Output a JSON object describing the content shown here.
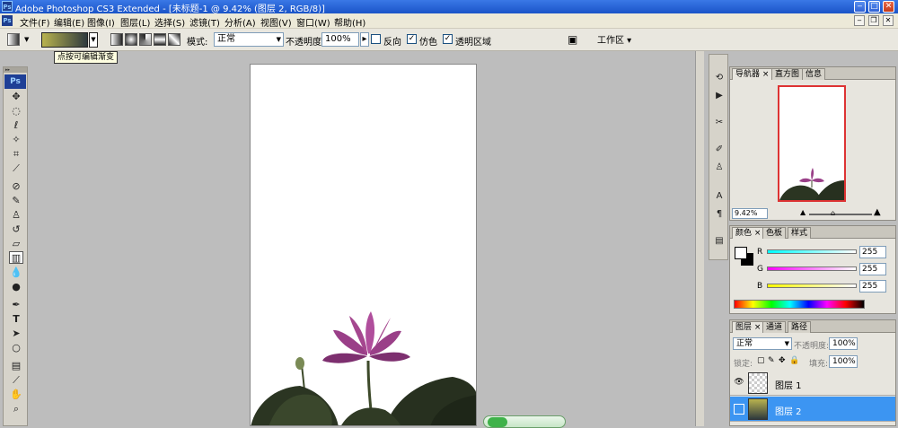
{
  "window": {
    "title": "Adobe Photoshop CS3 Extended - [未标题-1 @ 9.42% (图层 2, RGB/8)]",
    "app_icon": "Ps",
    "controls": [
      "minimize-icon",
      "maximize-icon",
      "close-icon"
    ]
  },
  "menubar": {
    "items": [
      "文件(F)",
      "编辑(E)",
      "图像(I)",
      "图层(L)",
      "选择(S)",
      "滤镜(T)",
      "分析(A)",
      "视图(V)",
      "窗口(W)",
      "帮助(H)"
    ]
  },
  "options": {
    "mode_label": "模式:",
    "mode_value": "正常",
    "opacity_label": "不透明度:",
    "opacity_value": "100%",
    "reverse_label": "反向",
    "reverse_checked": false,
    "dither_label": "仿色",
    "dither_checked": true,
    "transparency_label": "透明区域",
    "transparency_checked": true,
    "workspace_label": "工作区 ▾",
    "gradient_colors": [
      "#b9b34f",
      "#2f3a3e"
    ]
  },
  "tooltip": "点按可编辑渐变",
  "toolbox": {
    "logo": "Ps",
    "tools": [
      "move-tool-icon",
      "marquee-tool-icon",
      "lasso-tool-icon",
      "magic-wand-tool-icon",
      "crop-tool-icon",
      "eyedropper-tool-icon",
      "healing-brush-icon",
      "brush-tool-icon",
      "clone-stamp-icon",
      "history-brush-icon",
      "eraser-tool-icon",
      "gradient-tool-icon",
      "blur-tool-icon",
      "dodge-tool-icon",
      "pen-tool-icon",
      "type-tool-icon",
      "path-selection-icon",
      "shape-tool-icon",
      "notes-tool-icon",
      "eyedropper2-icon",
      "hand-tool-icon",
      "zoom-tool-icon"
    ],
    "active_tool": "gradient-tool-icon"
  },
  "navigator": {
    "tabs": [
      "导航器",
      "直方图",
      "信息"
    ],
    "zoom": "9.42%"
  },
  "color_panel": {
    "tabs": [
      "颜色",
      "色板",
      "样式"
    ],
    "channels": [
      {
        "name": "R",
        "value": "255",
        "color": "#3fd8e8"
      },
      {
        "name": "G",
        "value": "255",
        "color": "#e050e0"
      },
      {
        "name": "B",
        "value": "255",
        "color": "#e6e63a"
      }
    ]
  },
  "layers_panel": {
    "tabs": [
      "图层",
      "通道",
      "路径"
    ],
    "blend_mode": "正常",
    "opacity_label": "不透明度:",
    "opacity_value": "100%",
    "lock_label": "锁定:",
    "fill_label": "填充:",
    "fill_value": "100%",
    "layers": [
      {
        "name": "图层 1",
        "selected": false
      },
      {
        "name": "图层 2",
        "selected": true
      }
    ]
  }
}
